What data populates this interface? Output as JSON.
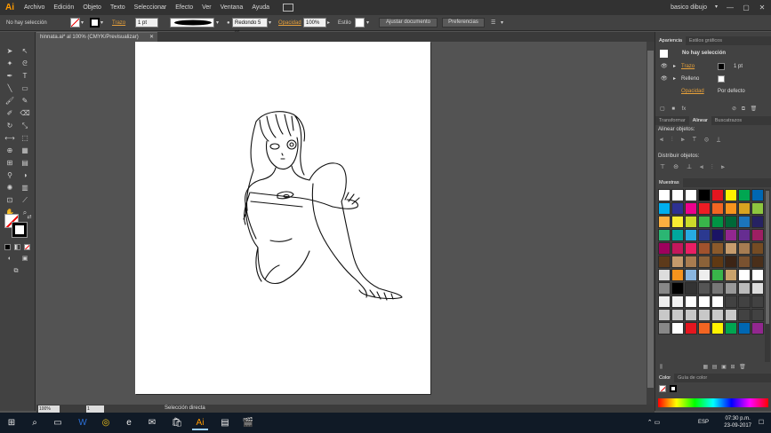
{
  "app": {
    "logo": "Ai",
    "menu": [
      "Archivo",
      "Edición",
      "Objeto",
      "Texto",
      "Seleccionar",
      "Efecto",
      "Ver",
      "Ventana",
      "Ayuda"
    ],
    "workspace": "basico dibujo",
    "window_buttons": [
      "—",
      "▢",
      "✕"
    ]
  },
  "control_bar": {
    "selection": "No hay selección",
    "stroke_label": "Trazo",
    "stroke_value": "1 pt",
    "brush": "Redondo 5 pt",
    "opacity_label": "Opacidad",
    "opacity_value": "100%",
    "style_label": "Estilo",
    "document_button": "Ajustar documento",
    "prefs_button": "Preferencias"
  },
  "document": {
    "tab_title": "hinnata.ai* al 100% (CMYK/Previsualizar)",
    "zoom": "100%",
    "page": "1",
    "status": "Selección directa"
  },
  "appearance_panel": {
    "tabs": [
      "Apariencia",
      "Estilos gráficos"
    ],
    "header": "No hay selección",
    "rows": [
      {
        "label": "Trazo",
        "value": "1 pt",
        "orange": true
      },
      {
        "label": "Relleno",
        "value": "",
        "orange": false
      },
      {
        "label": "Opacidad",
        "value": "Por defecto",
        "orange": true
      }
    ]
  },
  "align_panel": {
    "tabs": [
      "Transformar",
      "Alinear",
      "Buscatrazos"
    ],
    "align_objects": "Alinear objetos:",
    "distribute_objects": "Distribuir objetos:"
  },
  "swatches_panel": {
    "title": "Muestras",
    "rows": [
      [
        "#ffffff",
        "#ffffff",
        "#ffffff",
        "#000000",
        "#e5161f",
        "#fff200",
        "#00a651",
        "#0067b3"
      ],
      [
        "#00aeef",
        "#2e3192",
        "#ec008c",
        "#ed1c24",
        "#f26522",
        "#f7941d",
        "#d8a320",
        "#8dc63f"
      ],
      [
        "#fbb040",
        "#f9ed32",
        "#cbdb2a",
        "#39b54a",
        "#009444",
        "#006838",
        "#1c75bc",
        "#262262"
      ],
      [
        "#2bb673",
        "#00a79d",
        "#27aae1",
        "#2b3990",
        "#1b1464",
        "#92278f",
        "#662d91",
        "#9e1f63"
      ],
      [
        "#9e005d",
        "#c2185b",
        "#e91e63",
        "#a0522d",
        "#8b5a2b",
        "#c69c6d",
        "#a67c52",
        "#754c24"
      ],
      [
        "#5d3a1a",
        "#c49a6c",
        "#a97c50",
        "#8b6239",
        "#603913",
        "#3c2415",
        "#7a5230",
        "#4a2f1a"
      ],
      [
        "#dddddd",
        "#f7941d",
        "#8ab6e0",
        "#eeeeee",
        "#39b54a",
        "#c9a26b",
        "#ffffff",
        "#ffffff"
      ],
      [
        "#888888",
        "#000000",
        "#333333",
        "#555555",
        "#777777",
        "#999999",
        "#bbbbbb",
        "#dddddd"
      ],
      [
        "#eeeeee",
        "#f2f2f2",
        "#ffffff",
        "#ffffff",
        "#ffffff",
        "#424242",
        "#424242",
        "#424242"
      ],
      [
        "#c8c8c8",
        "#c8c8c8",
        "#c8c8c8",
        "#c8c8c8",
        "#c8c8c8",
        "#c8c8c8",
        "#424242",
        "#424242"
      ],
      [
        "#888888",
        "#ffffff",
        "#e5161f",
        "#f26522",
        "#fff200",
        "#00a651",
        "#0067b3",
        "#92278f"
      ]
    ]
  },
  "color_panel": {
    "tabs": [
      "Color",
      "Guía de color"
    ]
  },
  "taskbar": {
    "time": "07:30 p.m.",
    "date": "23-09-2017",
    "lang": "ESP"
  }
}
